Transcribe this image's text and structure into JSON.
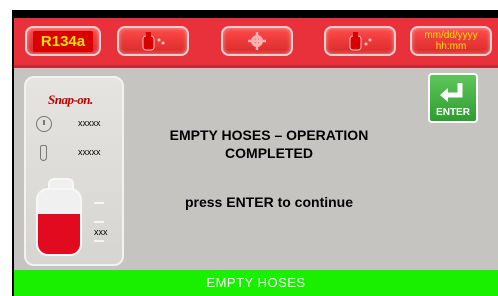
{
  "header": {
    "refrigerant": "R134a",
    "icons": [
      "tank-fill-icon",
      "gear-icon",
      "tank-empty-icon"
    ],
    "date": "mm/dd/yyyy",
    "time": "hh:mm"
  },
  "side_panel": {
    "brand": "Snap-on.",
    "pressure": "xxxxx",
    "temperature": "xxxxx",
    "tank_value": "xxx",
    "tank_level": 0.62
  },
  "main": {
    "message_line1": "EMPTY HOSES – OPERATION",
    "message_line2": "COMPLETED",
    "prompt": "press ENTER to continue"
  },
  "enter_button": {
    "label": "ENTER"
  },
  "status_bar": {
    "text": "EMPTY HOSES"
  },
  "colors": {
    "header": "#e8313a",
    "status": "#18f000",
    "panel": "#c5c4c1",
    "enter": "#2e9d30"
  }
}
